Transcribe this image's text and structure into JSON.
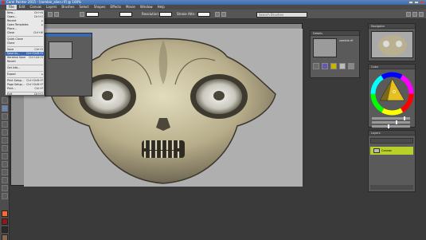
{
  "window": {
    "title": "Corel Painter 2015 - [zombie_alien.rif] @ 100%"
  },
  "menubar": [
    "File",
    "Edit",
    "Canvas",
    "Layers",
    "Brushes",
    "Select",
    "Shapes",
    "Effects",
    "Movie",
    "Window",
    "Help"
  ],
  "toolbar": {
    "resolution_label": "Resolution:",
    "stroke_label": "Stroke Attn:",
    "search_placeholder": "Search Brushes"
  },
  "file_menu": [
    {
      "label": "New...",
      "shortcut": "Ctrl+N"
    },
    {
      "label": "Open...",
      "shortcut": "Ctrl+O"
    },
    {
      "label": "Recent"
    },
    {
      "label": "Open Templates"
    },
    {
      "label": "Place..."
    },
    {
      "label": "Close",
      "shortcut": "Ctrl+W"
    },
    {
      "label": "Quick Clone"
    },
    {
      "label": "Clone"
    },
    {
      "label": "Save",
      "shortcut": "Ctrl+S"
    },
    {
      "label": "Save As...",
      "shortcut": "Ctrl+Shift+S"
    },
    {
      "label": "Iterative Save",
      "shortcut": "Ctrl+Alt+S"
    },
    {
      "label": "Revert"
    },
    {
      "label": "Get Info..."
    },
    {
      "label": "Export"
    },
    {
      "label": "Print Setup...",
      "shortcut": "Ctrl+Shift+P"
    },
    {
      "label": "Page Setup...",
      "shortcut": "Ctrl+Shift+P"
    },
    {
      "label": "Print...",
      "shortcut": "Ctrl+P"
    },
    {
      "label": "Exit",
      "shortcut": "Ctrl+Q"
    }
  ],
  "panels": {
    "navigator": {
      "title": "Navigator"
    },
    "details": {
      "title": "Details",
      "filename": "zombie.rif"
    },
    "color": {
      "title": "Color"
    },
    "layers": {
      "title": "Layers",
      "layer_name": "Canvas"
    }
  },
  "colors": {
    "accent": "#3b6aa8",
    "layer_highlight": "#b9cf2a",
    "canvas_gray": "#afafaf",
    "main_color": "#ff6a2a"
  }
}
